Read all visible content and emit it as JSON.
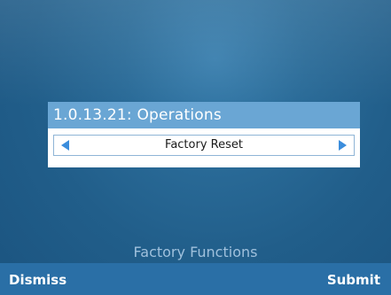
{
  "dialog": {
    "title": "1.0.13.21: Operations",
    "selector": {
      "value": "Factory Reset",
      "left_icon": "triangle-left-icon",
      "right_icon": "triangle-right-icon"
    }
  },
  "footer": {
    "menu_title": "Factory Functions"
  },
  "softkeys": {
    "left_label": "Dismiss",
    "right_label": "Submit"
  },
  "colors": {
    "background": "#215e8a",
    "title_bar": "#6aa6d4",
    "arrow": "#3b8ddc",
    "softkey_bar": "#2a6fa6"
  }
}
